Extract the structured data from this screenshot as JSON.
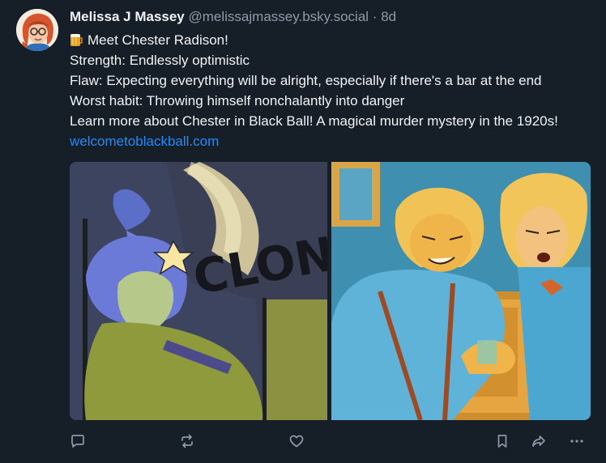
{
  "post": {
    "author": {
      "display_name": "Melissa J Massey",
      "handle": "@melissajmassey.bsky.social",
      "separator": "·",
      "time": "8d",
      "avatar_icon": "avatar-portrait"
    },
    "text": {
      "line1_emoji": "beer-mug-icon",
      "line1": "Meet Chester Radison!",
      "line2": "Strength: Endlessly optimistic",
      "line3": "Flaw: Expecting everything will be alright, especially if there's a bar at the end",
      "line4": "Worst habit: Throwing himself nonchalantly into danger",
      "line5": "Learn more about Chester in Black Ball! A magical murder mystery in the 1920s!",
      "link": "welcometoblackball.com"
    },
    "images": [
      {
        "icon": "comic-panel-clonk-illustration",
        "sound_effect": "CLONK"
      },
      {
        "icon": "comic-panel-bar-illustration"
      }
    ],
    "actions": [
      {
        "icon": "reply-icon"
      },
      {
        "icon": "repost-icon"
      },
      {
        "icon": "like-icon"
      },
      {
        "icon": "bookmark-icon"
      },
      {
        "icon": "share-icon"
      },
      {
        "icon": "more-icon"
      }
    ],
    "colors": {
      "background": "#161e27",
      "text": "#f1f3f5",
      "muted": "#8d9aa8",
      "link": "#208bfe"
    }
  }
}
